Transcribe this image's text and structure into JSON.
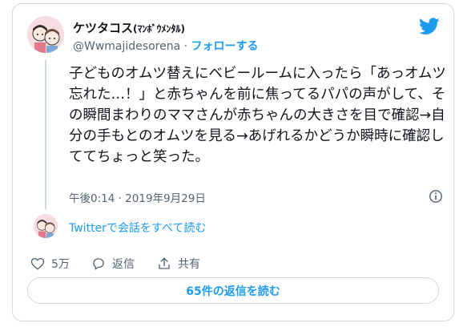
{
  "author": {
    "display_name": "ケツタコス",
    "name_suffix": "(ﾏﾝﾎﾞｳﾒﾝﾀﾙ)",
    "handle": "@Wwmajidesorena",
    "separator": " · ",
    "follow_label": "フォローする",
    "avatar_icon": "avatar-illustration"
  },
  "brand": {
    "icon": "twitter-bird-icon",
    "color": "#1d9bf0"
  },
  "tweet": {
    "text": "子どものオムツ替えにベビールームに入ったら「あっオムツ忘れた…！」と赤ちゃんを前に焦ってるパパの声がして、その瞬間まわりのママさんが赤ちゃんの大きさを目で確認→自分の手もとのオムツを見る→あげれるかどうか瞬時に確認しててちょっと笑った。",
    "timestamp": "午後0:14 · 2019年9月29日",
    "info_icon": "info-icon"
  },
  "conversation_link": "Twitterで会話をすべて読む",
  "actions": {
    "like_icon": "heart-icon",
    "like_count": "5万",
    "reply_icon": "reply-bubble-icon",
    "reply_label": "返信",
    "share_icon": "share-icon",
    "share_label": "共有"
  },
  "read_replies_button": "65件の返信を読む",
  "colors": {
    "accent": "#1d9bf0",
    "text_primary": "#0f1419",
    "text_secondary": "#536471",
    "border": "#cfd9de"
  }
}
